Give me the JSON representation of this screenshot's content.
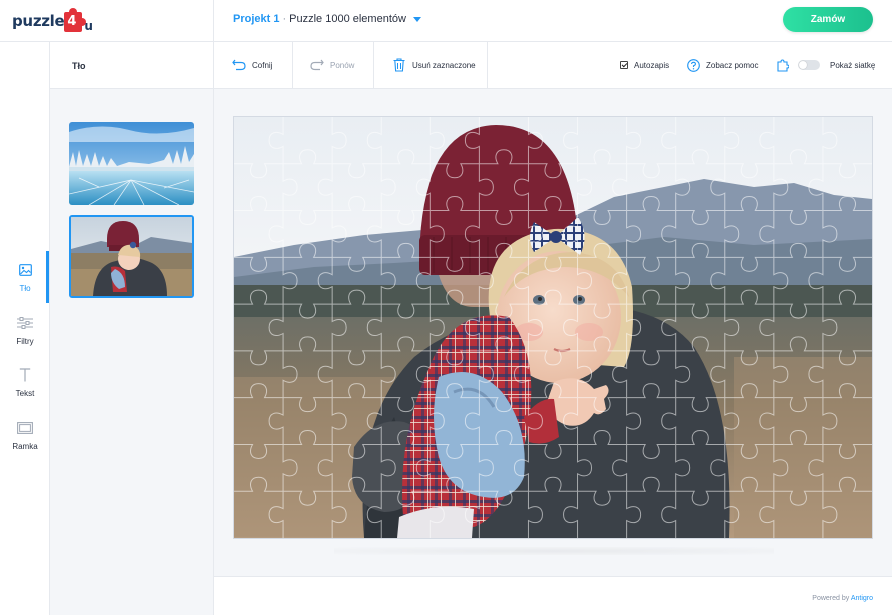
{
  "app": {
    "logo_text": "puzzle",
    "logo_number": "4",
    "logo_suffix": "u"
  },
  "header": {
    "project_name": "Projekt 1",
    "separator": "·",
    "project_title": "Puzzle 1000 elementów",
    "order_label": "Zamów"
  },
  "rail": {
    "items": [
      {
        "label": "Tło",
        "icon": "image-icon",
        "active": true
      },
      {
        "label": "Filtry",
        "icon": "sliders-icon",
        "active": false
      },
      {
        "label": "Tekst",
        "icon": "text-icon",
        "active": false
      },
      {
        "label": "Ramka",
        "icon": "frame-icon",
        "active": false
      }
    ]
  },
  "panel": {
    "title": "Tło",
    "thumbnails": [
      {
        "subject": "frozen lake with snowy trees",
        "selected": false
      },
      {
        "subject": "adult hugging toddler in field",
        "selected": true
      }
    ]
  },
  "toolbar": {
    "undo_label": "Cofnij",
    "redo_label": "Ponów",
    "delete_label": "Usuń zaznaczone",
    "autosave_label": "Autozapis",
    "autosave_checked": true,
    "help_label": "Zobacz pomoc",
    "grid_label": "Pokaż siatkę",
    "grid_on": false
  },
  "canvas": {
    "image_subject": "adult in maroon beanie hugging toddler with bow",
    "grid_columns": 13,
    "grid_rows": 9
  },
  "footer": {
    "powered_prefix": "Powered by",
    "powered_brand": "Antigro"
  },
  "colors": {
    "accent": "#2196f3",
    "order_button": "#1cc08e",
    "logo_red": "#e2323a",
    "logo_navy": "#1f3a5f"
  }
}
